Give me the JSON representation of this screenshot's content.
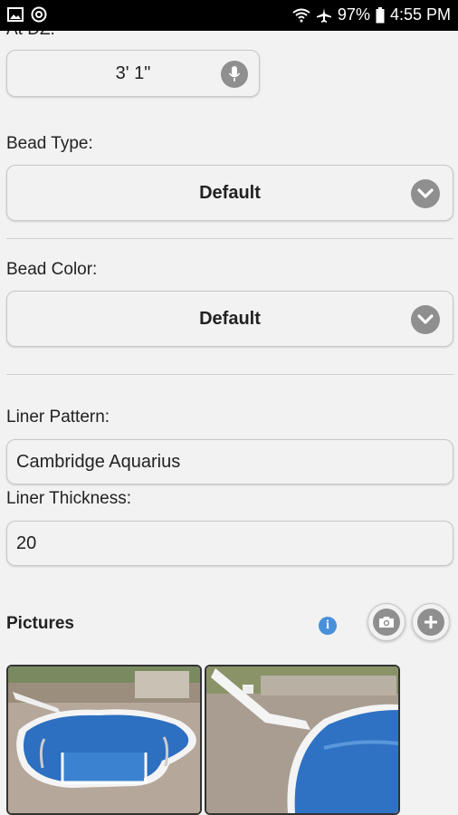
{
  "status_bar": {
    "battery": "97%",
    "time": "4:55 PM",
    "icons": [
      "image-icon",
      "at-icon",
      "wifi-icon",
      "airplane-icon",
      "battery-icon"
    ]
  },
  "measure": {
    "label": "At DZ:",
    "value": "3' 1\""
  },
  "bead_type": {
    "label": "Bead Type:",
    "value": "Default"
  },
  "bead_color": {
    "label": "Bead Color:",
    "value": "Default"
  },
  "liner_pattern": {
    "label": "Liner Pattern:",
    "value": "Cambridge Aquarius"
  },
  "liner_thickness": {
    "label": "Liner Thickness:",
    "value": "20"
  },
  "pictures": {
    "title": "Pictures",
    "info_glyph": "i",
    "thumbnails": [
      "pool-photo-1",
      "pool-photo-2"
    ]
  },
  "colors": {
    "background": "#f2f2f2",
    "icon_gray": "#8f8f8f",
    "info_blue": "#4a90d9"
  }
}
